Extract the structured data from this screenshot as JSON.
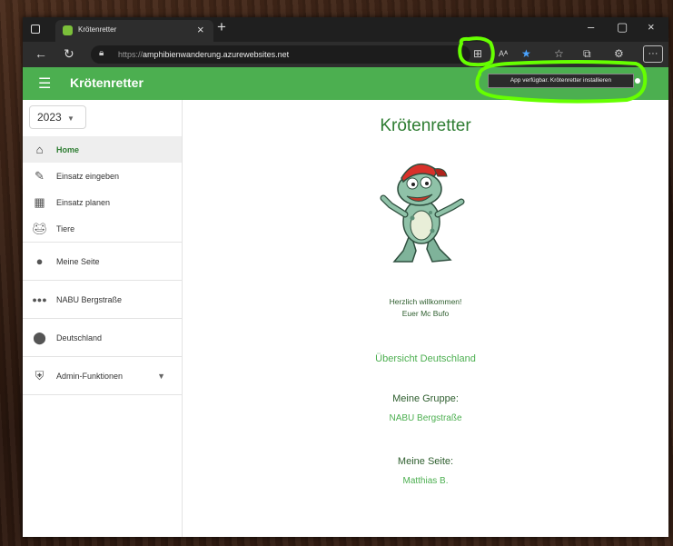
{
  "browser": {
    "tab_title": "Krötenretter",
    "tab_close": "×",
    "new_tab": "+",
    "url_scheme": "https://",
    "url_host": "amphibienwanderung.azurewebsites.net",
    "minimize": "–",
    "maximize": "▢",
    "close": "×",
    "more": "···",
    "tooltip": "App verfügbar. Krötenretter installieren"
  },
  "appbar": {
    "title": "Krötenretter"
  },
  "sidebar": {
    "year": "2023",
    "items": [
      {
        "label": "Home"
      },
      {
        "label": "Einsatz eingeben"
      },
      {
        "label": "Einsatz planen"
      },
      {
        "label": "Tiere"
      },
      {
        "label": "Meine Seite"
      },
      {
        "label": "NABU Bergstraße"
      },
      {
        "label": "Deutschland"
      },
      {
        "label": "Admin-Funktionen"
      }
    ]
  },
  "main": {
    "title": "Krötenretter",
    "welcome_1": "Herzlich willkommen!",
    "welcome_2": "Euer Mc Bufo",
    "overview_link": "Übersicht Deutschland",
    "group_label": "Meine Gruppe:",
    "group_link": "NABU Bergstraße",
    "page_label": "Meine Seite:",
    "page_link": "Matthias B."
  },
  "colors": {
    "brand": "#4caf50",
    "link": "#2e7d32",
    "highlight": "#66ff00"
  }
}
